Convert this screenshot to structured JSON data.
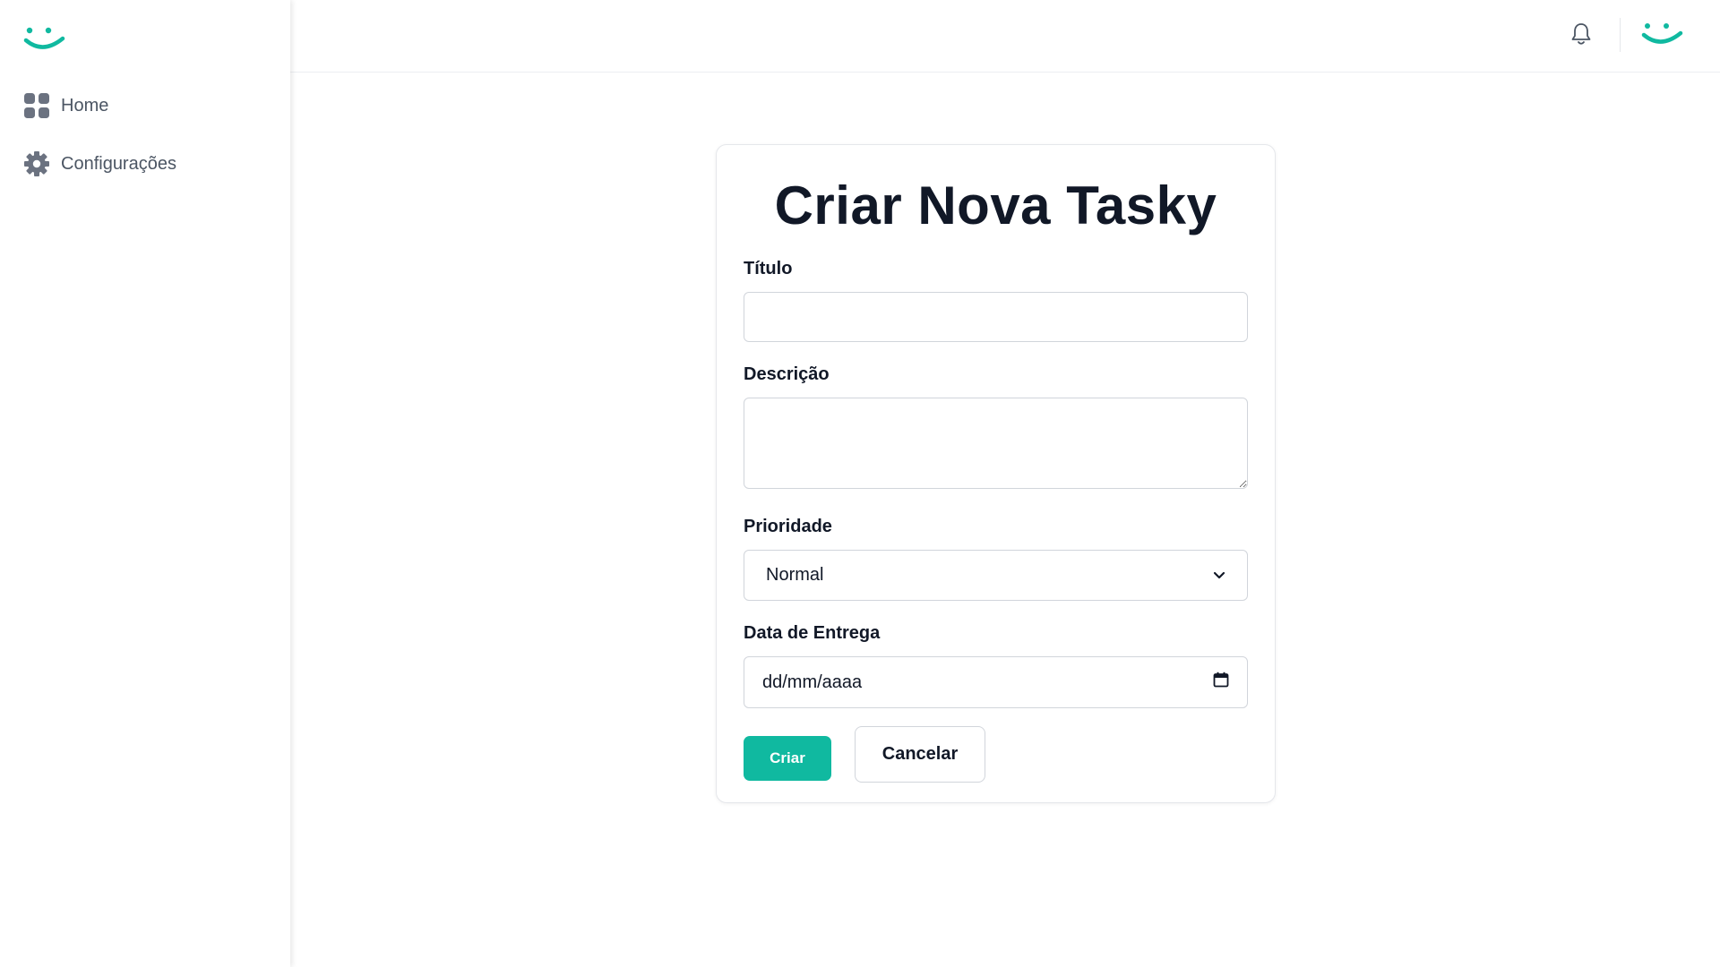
{
  "sidebar": {
    "logo_icon": "smile-logo-icon",
    "items": [
      {
        "label": "Home",
        "icon": "grid-icon"
      },
      {
        "label": "Configurações",
        "icon": "gear-icon"
      }
    ]
  },
  "header": {
    "notification_icon": "bell-icon",
    "profile_icon": "smile-logo-icon"
  },
  "form": {
    "title": "Criar Nova Tasky",
    "fields": {
      "titulo": {
        "label": "Título",
        "value": ""
      },
      "descricao": {
        "label": "Descrição",
        "value": ""
      },
      "prioridade": {
        "label": "Prioridade",
        "selected": "Normal"
      },
      "data_entrega": {
        "label": "Data de Entrega",
        "placeholder": "dd/mm/aaaa"
      }
    },
    "submit_label": "Criar",
    "cancel_label": "Cancelar"
  },
  "colors": {
    "accent": "#10b9a0",
    "text": "#111827",
    "muted": "#4b5563",
    "border": "#d1d5db"
  }
}
